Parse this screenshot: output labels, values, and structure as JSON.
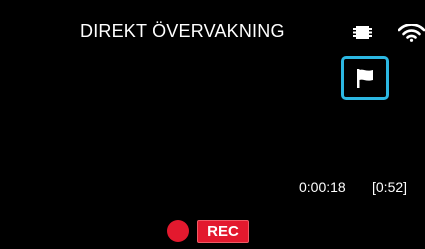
{
  "header": {
    "title": "DIREKT ÖVERVAKNING",
    "icons": [
      "battery-icon",
      "wifi-icon"
    ]
  },
  "controls": {
    "flag_button_icon": "flag-icon",
    "accent_color": "#2cb8e3"
  },
  "recording": {
    "elapsed": "0:00:18",
    "remaining": "[0:52]",
    "rec_label": "REC",
    "rec_color": "#e3192e"
  }
}
